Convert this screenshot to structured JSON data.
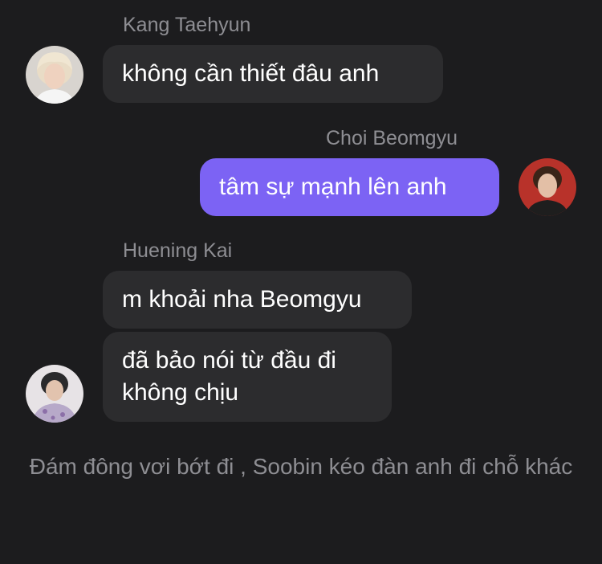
{
  "messages": [
    {
      "sender": "Kang Taehyun",
      "avatar_icon": "avatar-kang-taehyun",
      "direction": "incoming",
      "texts": [
        "không cần thiết đâu anh"
      ]
    },
    {
      "sender": "Choi Beomgyu",
      "avatar_icon": "avatar-choi-beomgyu",
      "direction": "outgoing",
      "texts": [
        "tâm sự mạnh lên anh"
      ]
    },
    {
      "sender": "Huening Kai",
      "avatar_icon": "avatar-huening-kai",
      "direction": "incoming",
      "texts": [
        "m khoải nha Beomgyu",
        "đã bảo nói từ đầu đi không chịu"
      ]
    }
  ],
  "narration": "Đám đông vơi bớt đi , Soobin kéo đàn anh đi chỗ khác",
  "colors": {
    "background": "#1c1c1e",
    "incoming_bubble": "#2c2c2e",
    "outgoing_bubble": "#7c63f4",
    "secondary_text": "#8e8e93"
  }
}
